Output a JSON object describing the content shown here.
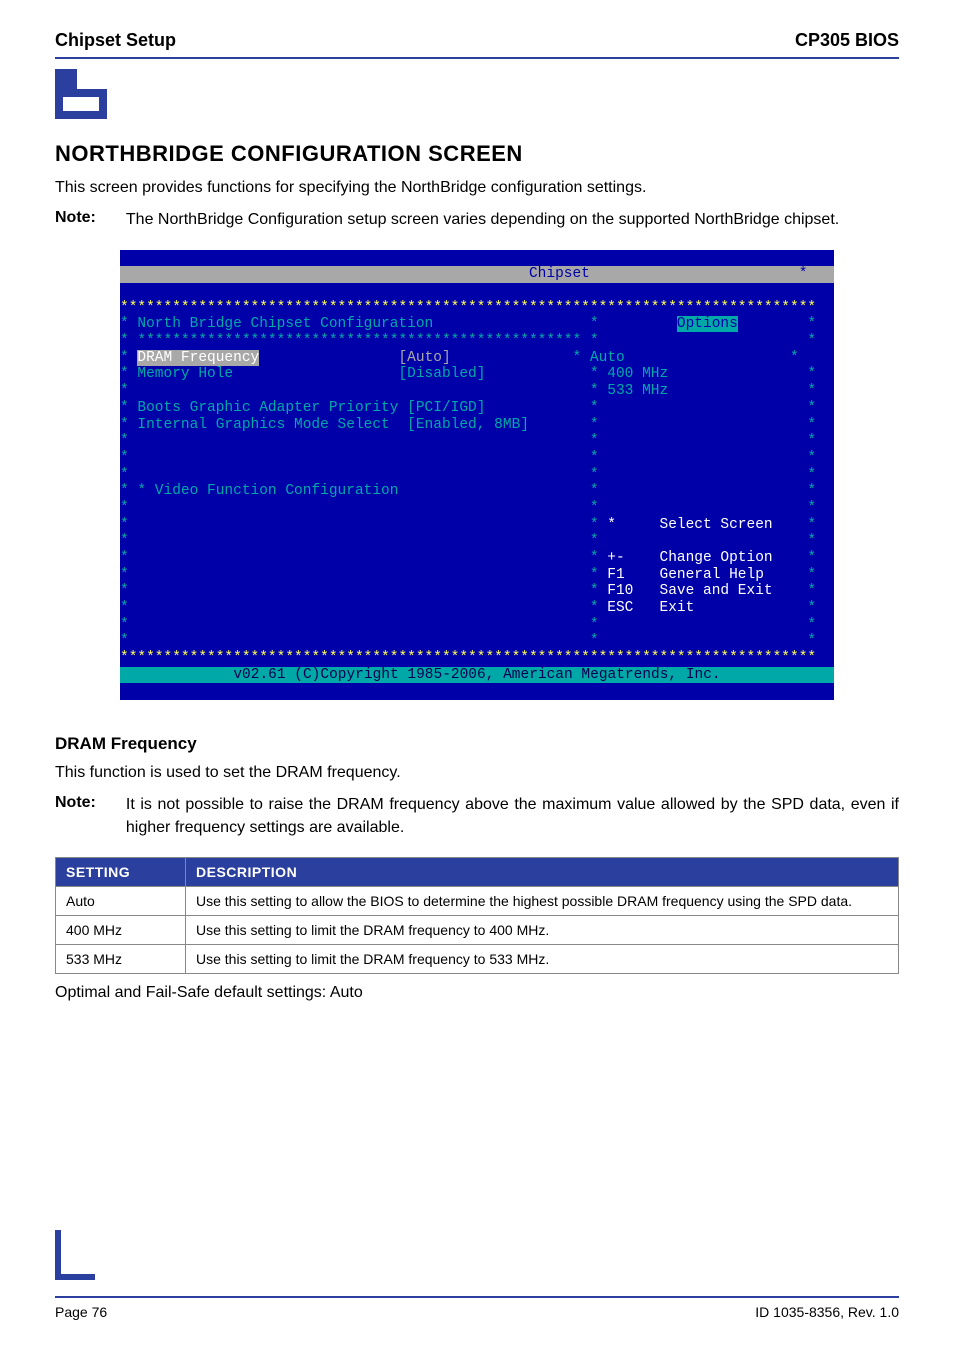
{
  "header": {
    "left": "Chipset Setup",
    "right": "CP305 BIOS"
  },
  "section": {
    "title": "NORTHBRIDGE CONFIGURATION SCREEN",
    "intro": "This screen provides functions for specifying the NorthBridge configuration settings.",
    "note_label": "Note:",
    "note_text": "The NorthBridge Configuration setup screen varies depending on the supported NorthBridge chipset."
  },
  "bios": {
    "title_prefix_spaces": "                                               ",
    "title": "Chipset",
    "star_row": "********************************************************************************",
    "main_header": "* North Bridge Chipset Configuration                  *         ",
    "options_label": "Options",
    "sub_star": "* *************************************************** *                        *",
    "row_dram_l": "* ",
    "row_dram_label": "DRAM Frequency",
    "row_dram_sp": "                ",
    "row_dram_val": "[Auto]",
    "row_dram_r": "              * Auto                   *",
    "row_mem": "* Memory Hole                   [Disabled]            * 400 MHz                *",
    "row_blank1": "*                                                     * 533 MHz                *",
    "row_bgap": "* Boots Graphic Adapter Priority [PCI/IGD]            *                        *",
    "row_igms": "* Internal Graphics Mode Select  [Enabled, 8MB]       *                        *",
    "row_blank2": "*                                                     *                        *",
    "row_blank3": "*                                                     *                        *",
    "row_blank4": "*                                                     *                        *",
    "row_vfc": "* * Video Function Configuration                      *                        *",
    "row_blank5": "*                                                     *                        *",
    "row_sel_pre": "*                                                     * ",
    "row_sel_key": "*",
    "row_sel_txt": "     Select Screen    ",
    "row_sel_end": "*",
    "row_blank6": "*                                                     *                        *",
    "row_chg_pre": "*                                                     * ",
    "row_chg_key": "+-",
    "row_chg_txt": "    Change Option    ",
    "row_hlp_pre": "*                                                     * ",
    "row_hlp_key": "F1",
    "row_hlp_txt": "    General Help     ",
    "row_sav_pre": "*                                                     * ",
    "row_sav_key": "F10",
    "row_sav_txt": "   Save and Exit    ",
    "row_esc_pre": "*                                                     * ",
    "row_esc_key": "ESC",
    "row_esc_txt": "   Exit             ",
    "row_blank7": "*                                                     *                        *",
    "row_blank8": "*                                                     *                        *",
    "bottom": "v02.61 (C)Copyright 1985-2006, American Megatrends, Inc."
  },
  "dram": {
    "heading": "DRAM Frequency",
    "intro": "This function is used to set the DRAM frequency.",
    "note_label": "Note:",
    "note_text": "It is not possible to raise the DRAM frequency above the maximum value allowed by the SPD data, even if higher frequency settings are available.",
    "th_setting": "SETTING",
    "th_desc": "DESCRIPTION",
    "rows": [
      {
        "setting": "Auto",
        "desc": "Use this setting to allow the BIOS to determine the highest possible DRAM frequency using the SPD data."
      },
      {
        "setting": "400 MHz",
        "desc": "Use this setting to limit the DRAM frequency to 400 MHz."
      },
      {
        "setting": "533 MHz",
        "desc": "Use this setting to limit the DRAM frequency to 533 MHz."
      }
    ],
    "footer_line": "Optimal and Fail-Safe default settings: Auto"
  },
  "footer": {
    "left": "Page 76",
    "right": "ID 1035-8356, Rev. 1.0"
  }
}
